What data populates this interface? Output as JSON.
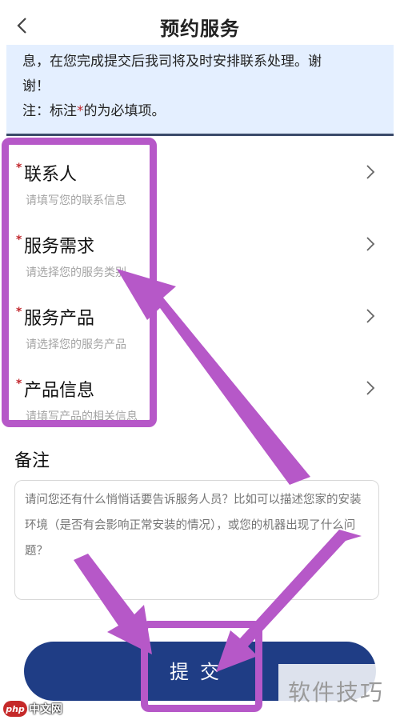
{
  "header": {
    "title": "预约服务"
  },
  "notice": {
    "line1": "息，在您完成提交后我司将及时安排联系处理。谢",
    "line2": "谢！",
    "note_prefix": "注：标注",
    "note_star": "*",
    "note_suffix": "的为必填项。"
  },
  "fields": [
    {
      "label": "联系人",
      "hint": "请填写您的联系信息",
      "required": true
    },
    {
      "label": "服务需求",
      "hint": "请选择您的服务类别",
      "required": true
    },
    {
      "label": "服务产品",
      "hint": "请选择您的服务产品",
      "required": true
    },
    {
      "label": "产品信息",
      "hint": "请填写产品的相关信息",
      "required": true
    }
  ],
  "remarks": {
    "title": "备注",
    "placeholder": "请问您还有什么悄悄话要告诉服务人员？比如可以描述您家的安装环境（是否有会影响正常安装的情况），或您的机器出现了什么问题？"
  },
  "submit": {
    "label": "提交"
  },
  "watermarks": {
    "right": "软件技巧",
    "left_logo": "php",
    "left_site": "中文网"
  },
  "colors": {
    "primary": "#1f3d85",
    "notice_bg": "#e4efff",
    "required": "#c1272d",
    "annotation": "#b658c8"
  }
}
